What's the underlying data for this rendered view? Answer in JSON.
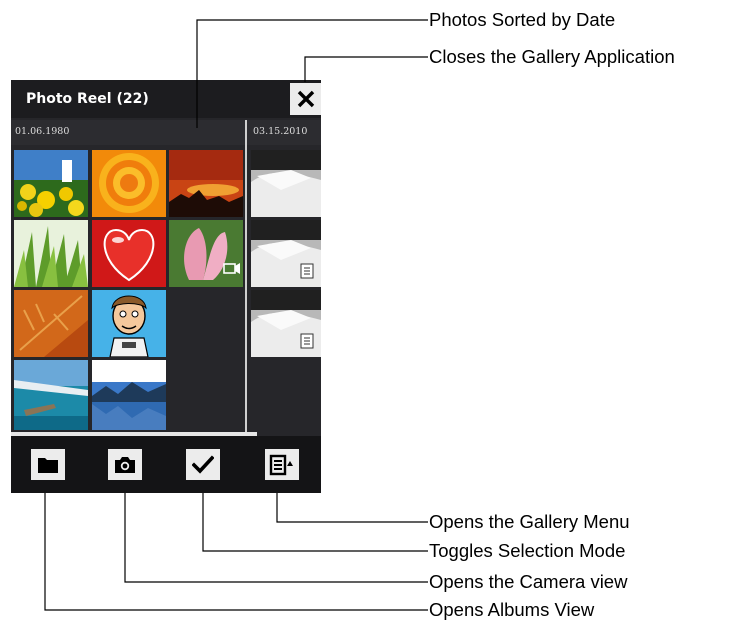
{
  "phone": {
    "title": "Photo Reel (22)",
    "icons": {
      "close": "close-icon",
      "albums": "folder-icon",
      "camera": "camera-icon",
      "select": "checkmark-icon",
      "menu": "menu-icon"
    },
    "groups": [
      {
        "date": "01.06.1980"
      },
      {
        "date": "03.15.2010"
      }
    ]
  },
  "callouts": {
    "photos_sorted": "Photos Sorted by Date",
    "closes_gallery": "Closes the Gallery Application",
    "gallery_menu": "Opens the Gallery Menu",
    "selection_mode": "Toggles Selection Mode",
    "camera_view": "Opens the Camera view",
    "albums_view": "Opens Albums View"
  }
}
